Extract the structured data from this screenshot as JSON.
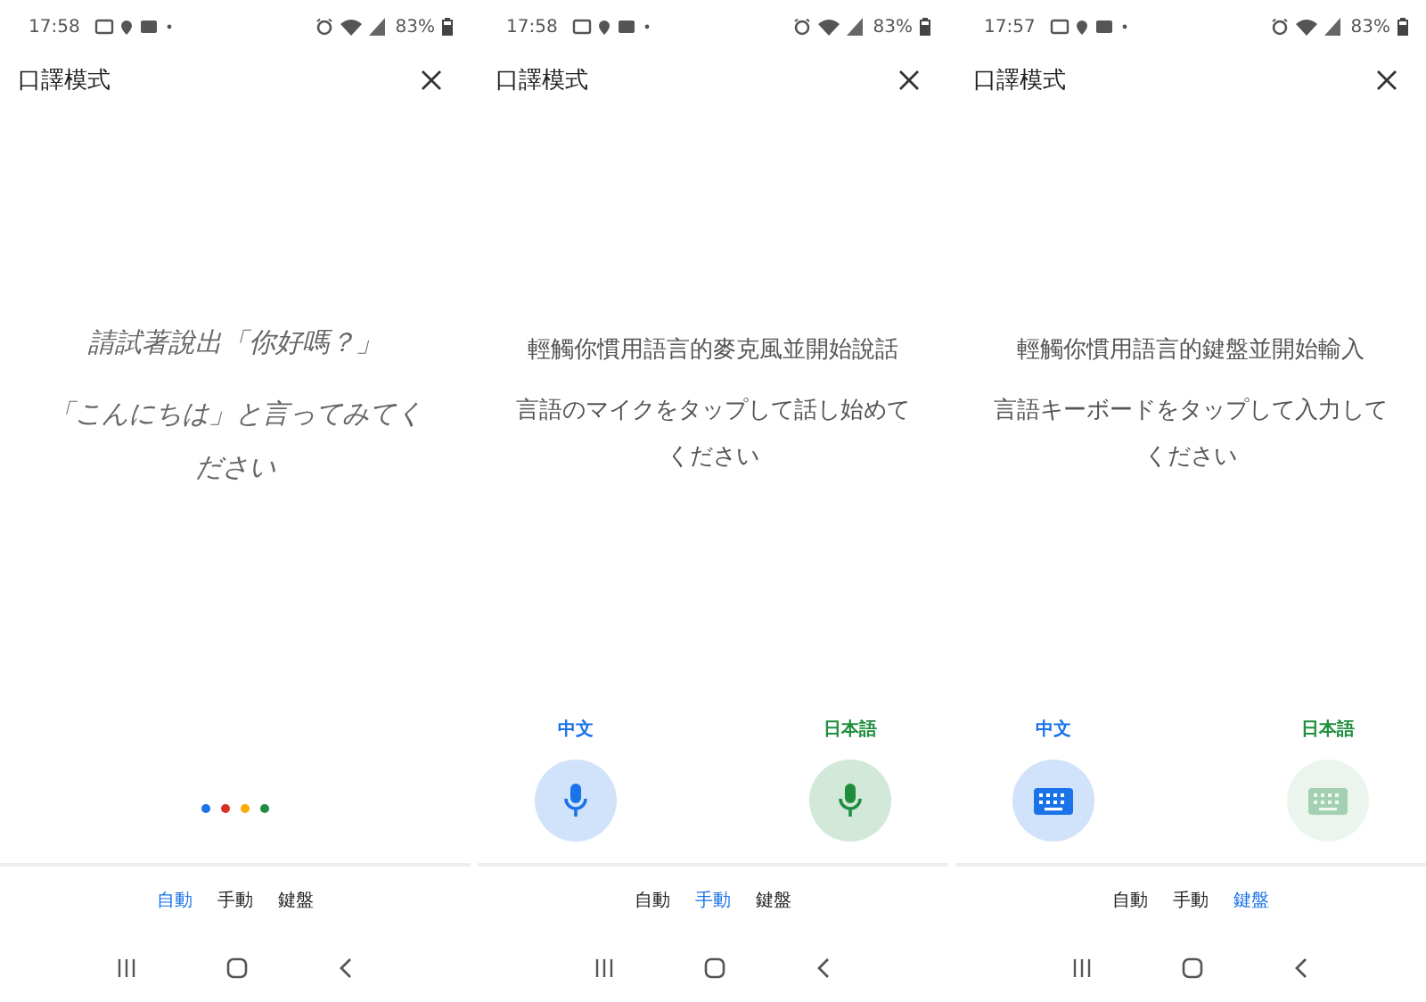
{
  "screens": [
    {
      "status_bar": {
        "time": "17:58",
        "battery": "83%"
      },
      "title": "口譯模式",
      "prompts": [
        {
          "kind": "example",
          "text": "請試著說出「你好嗎？」"
        },
        {
          "kind": "example",
          "text": "「こんにちは」と言ってみてください"
        }
      ],
      "listening_dots": [
        {
          "color": "#1a73e8"
        },
        {
          "color": "#d93025"
        },
        {
          "color": "#f9ab00"
        },
        {
          "color": "#1e8e3e"
        }
      ],
      "modes": [
        {
          "label": "自動",
          "selected": true
        },
        {
          "label": "手動",
          "selected": false
        },
        {
          "label": "鍵盤",
          "selected": false
        }
      ]
    },
    {
      "status_bar": {
        "time": "17:58",
        "battery": "83%"
      },
      "title": "口譯模式",
      "prompts": [
        {
          "kind": "instruction",
          "text": "輕觸你慣用語言的麥克風並開始說話"
        },
        {
          "kind": "instruction",
          "text": "言語のマイクをタップして話し始めてください"
        }
      ],
      "languages": [
        {
          "label": "中文",
          "kind": "mic",
          "color": "#1a73e8",
          "disabled": false
        },
        {
          "label": "日本語",
          "kind": "mic",
          "color": "#1e8e3e",
          "disabled": false
        }
      ],
      "modes": [
        {
          "label": "自動",
          "selected": false
        },
        {
          "label": "手動",
          "selected": true
        },
        {
          "label": "鍵盤",
          "selected": false
        }
      ]
    },
    {
      "status_bar": {
        "time": "17:57",
        "battery": "83%"
      },
      "title": "口譯模式",
      "prompts": [
        {
          "kind": "instruction",
          "text": "輕觸你慣用語言的鍵盤並開始輸入"
        },
        {
          "kind": "instruction",
          "text": "言語キーボードをタップして入力してください"
        }
      ],
      "languages": [
        {
          "label": "中文",
          "kind": "keyboard",
          "color": "#1a73e8",
          "disabled": false
        },
        {
          "label": "日本語",
          "kind": "keyboard",
          "color": "#1e8e3e",
          "disabled": true
        }
      ],
      "modes": [
        {
          "label": "自動",
          "selected": false
        },
        {
          "label": "手動",
          "selected": false
        },
        {
          "label": "鍵盤",
          "selected": true
        }
      ]
    }
  ]
}
